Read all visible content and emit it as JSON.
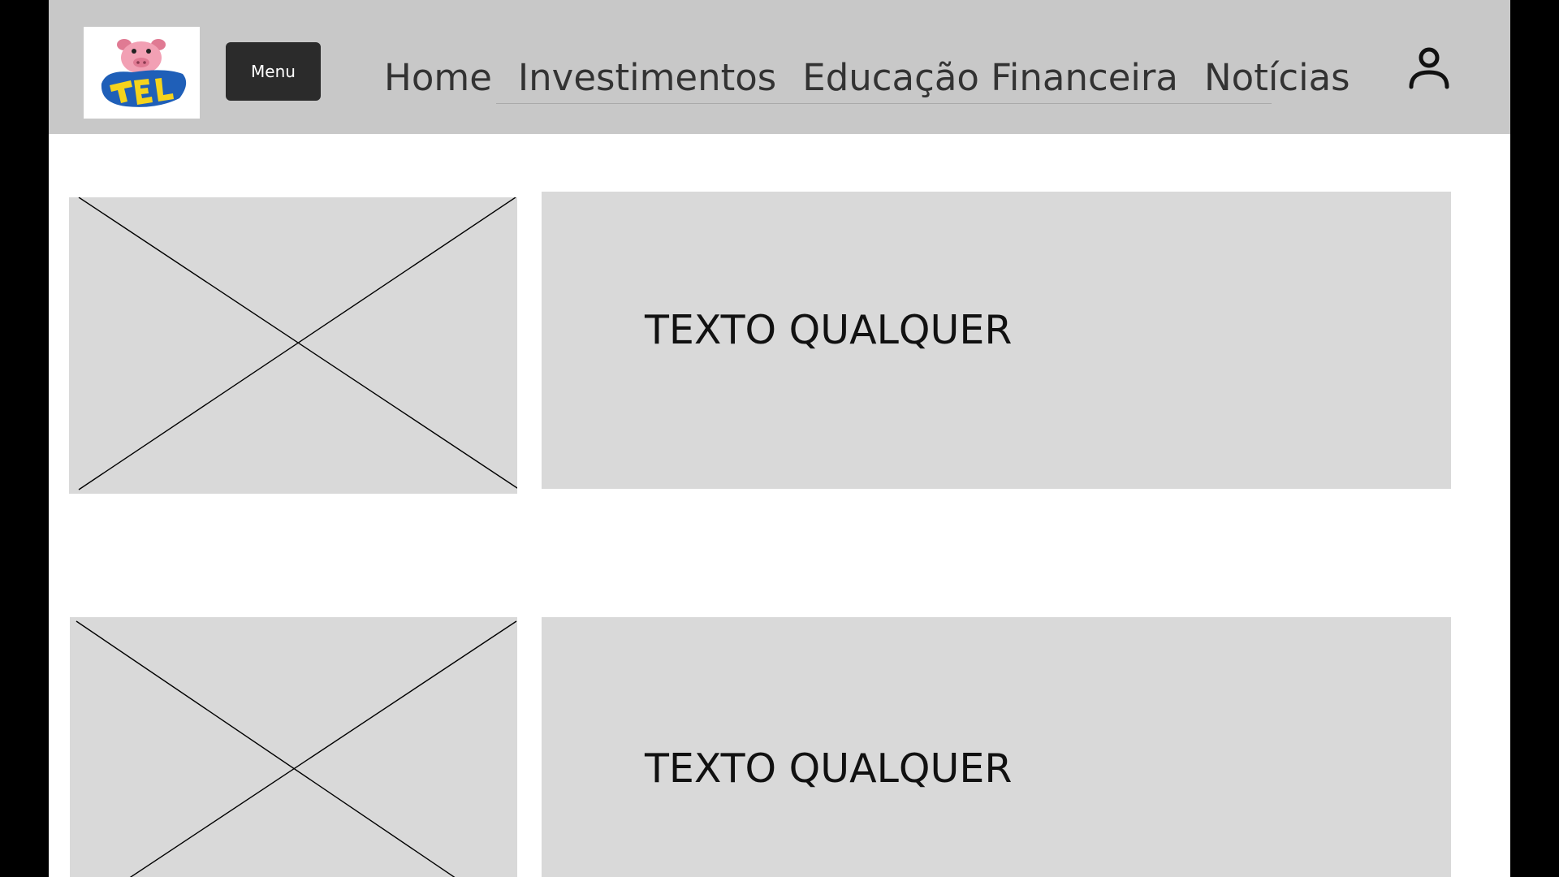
{
  "header": {
    "logo_text": "TELE SENA",
    "menu_label": "Menu",
    "nav": {
      "items": [
        {
          "label": "Home"
        },
        {
          "label": "Investimentos"
        },
        {
          "label": "Educação Financeira"
        },
        {
          "label": "Notícias"
        }
      ]
    },
    "user_icon": "user-icon"
  },
  "content": {
    "rows": [
      {
        "image_icon": "image-placeholder-icon",
        "text": "TEXTO QUALQUER"
      },
      {
        "image_icon": "image-placeholder-icon",
        "text": "TEXTO QUALQUER"
      }
    ]
  },
  "colors": {
    "header_bg": "#c8c8c8",
    "menu_button_bg": "#2b2b2b",
    "placeholder_bg": "#d9d9d9",
    "outer_bg": "#000000"
  }
}
